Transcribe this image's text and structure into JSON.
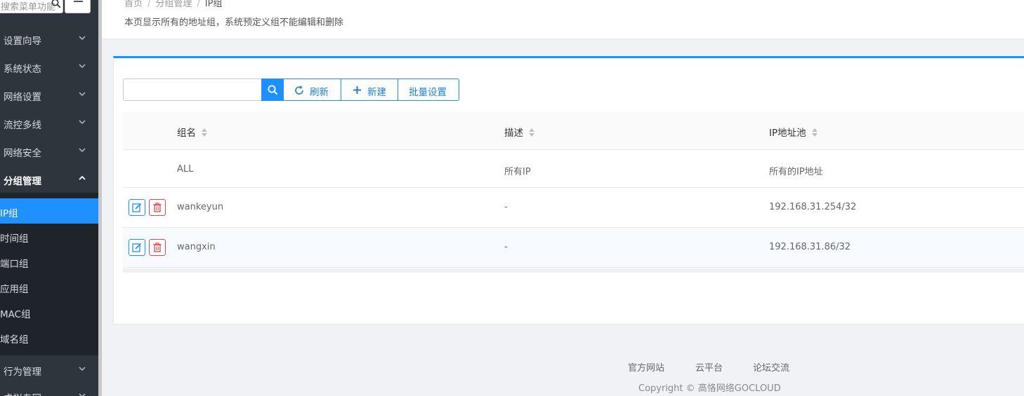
{
  "sidebar": {
    "search_placeholder": "搜索菜单功能",
    "menu": [
      {
        "label": "设置向导"
      },
      {
        "label": "系统状态"
      },
      {
        "label": "网络设置"
      },
      {
        "label": "流控多线"
      },
      {
        "label": "网络安全"
      },
      {
        "label": "分组管理"
      },
      {
        "label": "行为管理"
      },
      {
        "label": "虚拟专网"
      }
    ],
    "submenu": [
      {
        "label": "IP组"
      },
      {
        "label": "时间组"
      },
      {
        "label": "端口组"
      },
      {
        "label": "应用组"
      },
      {
        "label": "MAC组"
      },
      {
        "label": "域名组"
      }
    ]
  },
  "header": {
    "breadcrumb": [
      "首页",
      "分组管理",
      "IP组"
    ],
    "description": "本页显示所有的地址组，系统预定义组不能编辑和删除"
  },
  "toolbar": {
    "search_value": "",
    "refresh_label": "刷新",
    "new_label": "新建",
    "batch_label": "批量设置"
  },
  "table": {
    "columns": [
      "组名",
      "描述",
      "IP地址池"
    ],
    "rows": [
      {
        "name": "ALL",
        "desc": "所有IP",
        "pool": "所有的IP地址"
      },
      {
        "name": "wankeyun",
        "desc": "-",
        "pool": "192.168.31.254/32"
      },
      {
        "name": "wangxin",
        "desc": "-",
        "pool": "192.168.31.86/32"
      }
    ]
  },
  "footer": {
    "links": [
      "官方网站",
      "云平台",
      "论坛交流"
    ],
    "copyright": "Copyright © 高恪网络GOCLOUD"
  },
  "colors": {
    "accent": "#1e90ff",
    "sidebar_bg": "#2f353d",
    "delete": "#e0484b"
  }
}
